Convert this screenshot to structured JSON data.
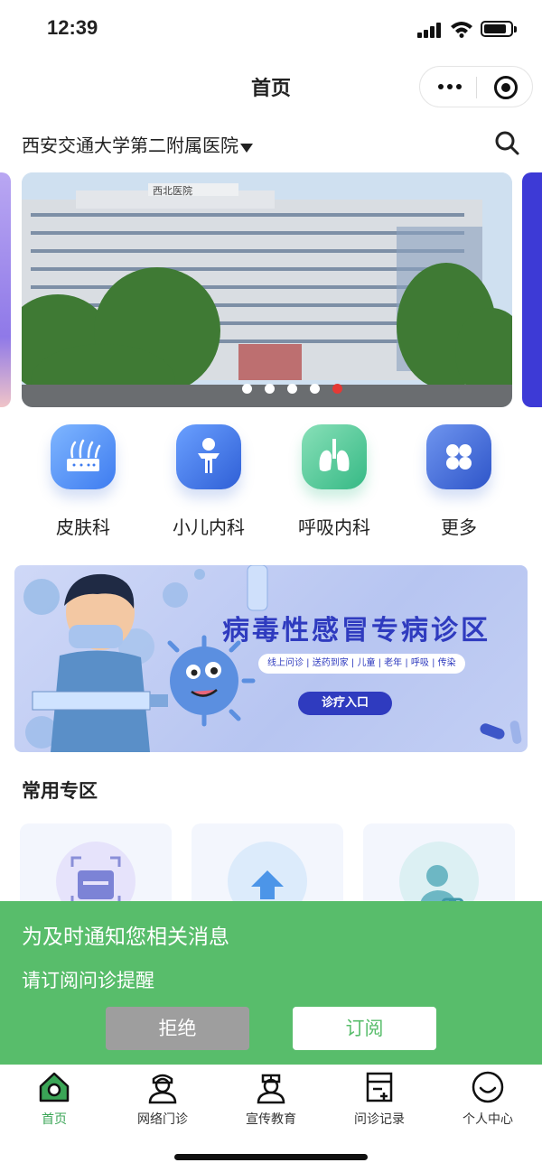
{
  "status_bar": {
    "time": "12:39"
  },
  "nav": {
    "title": "首页"
  },
  "hospital": {
    "name": "西安交通大学第二附属医院"
  },
  "banner": {
    "slide_count": 5,
    "active_index": 4,
    "sign_text": "西北医院"
  },
  "departments": [
    {
      "label": "皮肤科",
      "icon": "skin-icon"
    },
    {
      "label": "小儿内科",
      "icon": "child-icon"
    },
    {
      "label": "呼吸内科",
      "icon": "lungs-icon"
    },
    {
      "label": "更多",
      "icon": "grid-more-icon"
    }
  ],
  "promo": {
    "title": "病毒性感冒专病诊区",
    "tags": "线上问诊 | 送药到家 | 儿童 | 老年 | 呼吸 | 传染",
    "entry_label": "诊疗入口"
  },
  "common_section": {
    "title": "常用专区"
  },
  "subscribe": {
    "title": "为及时通知您相关消息",
    "desc": "请订阅问诊提醒",
    "reject_label": "拒绝",
    "subscribe_label": "订阅"
  },
  "tabbar": [
    {
      "label": "首页",
      "icon": "home-icon",
      "active": true
    },
    {
      "label": "网络门诊",
      "icon": "doctor-icon",
      "active": false
    },
    {
      "label": "宣传教育",
      "icon": "nurse-icon",
      "active": false
    },
    {
      "label": "问诊记录",
      "icon": "record-icon",
      "active": false
    },
    {
      "label": "个人中心",
      "icon": "profile-icon",
      "active": false
    }
  ],
  "colors": {
    "accent_green": "#58bd6b",
    "tab_active": "#3aa556",
    "promo_blue": "#2f3bbf"
  }
}
